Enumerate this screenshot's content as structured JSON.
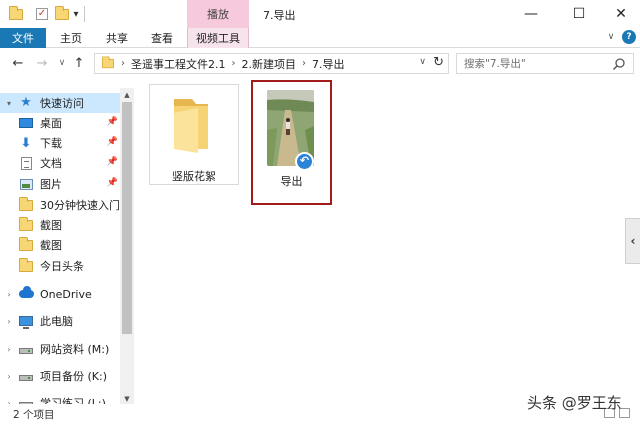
{
  "titlebar": {
    "context_tab": "播放",
    "title": "7.导出",
    "qa_dropdown": "▾",
    "minimize": "—",
    "maximize": "☐",
    "close": "✕"
  },
  "ribbon": {
    "tabs": [
      "文件",
      "主页",
      "共享",
      "查看",
      "视频工具"
    ],
    "expand": "∨",
    "help": "?"
  },
  "nav": {
    "back": "←",
    "forward": "→",
    "recent": "∨",
    "up": "↑"
  },
  "address": {
    "crumbs": [
      "圣遥事工程文件2.1",
      "2.新建项目",
      "7.导出"
    ],
    "separator": "›",
    "dropdown": "∨",
    "refresh": "↻"
  },
  "search": {
    "placeholder": "搜索\"7.导出\""
  },
  "sidebar": {
    "items": [
      {
        "label": "快速访问",
        "icon": "star-icon"
      },
      {
        "label": "桌面",
        "icon": "desktop-icon",
        "pinned": true
      },
      {
        "label": "下载",
        "icon": "download-icon",
        "pinned": true
      },
      {
        "label": "文档",
        "icon": "document-icon",
        "pinned": true
      },
      {
        "label": "图片",
        "icon": "pictures-icon",
        "pinned": true
      },
      {
        "label": "30分钟快速入门",
        "icon": "folder-icon"
      },
      {
        "label": "截图",
        "icon": "folder-icon"
      },
      {
        "label": "截图",
        "icon": "folder-icon"
      },
      {
        "label": "今日头条",
        "icon": "folder-icon"
      },
      {
        "label": "OneDrive",
        "icon": "onedrive-icon"
      },
      {
        "label": "此电脑",
        "icon": "computer-icon"
      },
      {
        "label": "网站资料 (M:)",
        "icon": "drive-icon"
      },
      {
        "label": "项目备份 (K:)",
        "icon": "drive-icon"
      },
      {
        "label": "学习练习 (L:)",
        "icon": "drive-icon"
      }
    ],
    "pin_glyph": "📌"
  },
  "content": {
    "items": [
      {
        "label": "竖版花絮",
        "type": "folder"
      },
      {
        "label": "导出",
        "type": "video-shortcut"
      }
    ],
    "shortcut_glyph": "↶",
    "side_toggle": "‹"
  },
  "status": {
    "count": "2 个项目"
  },
  "watermark": "头条 @罗王东",
  "colors": {
    "accent": "#1a79b5",
    "context_tab": "#f6c9dc",
    "selection": "#cce8ff",
    "highlight_border": "#a11b1b"
  }
}
